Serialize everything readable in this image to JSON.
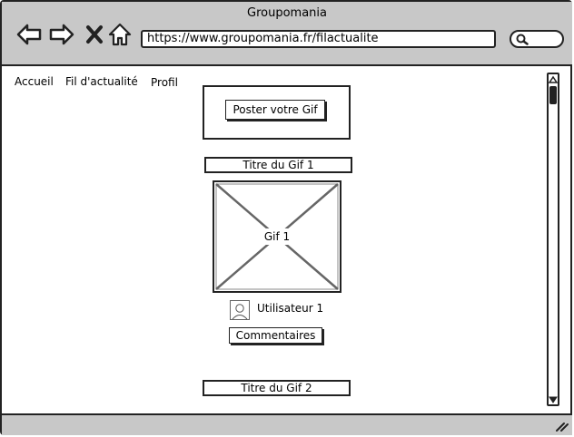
{
  "window": {
    "title": "Groupomania"
  },
  "toolbar": {
    "url": "https://www.groupomania.fr/filactualite",
    "icons": [
      "back-arrow-icon",
      "forward-arrow-icon",
      "close-x-icon",
      "home-icon",
      "search-icon"
    ]
  },
  "nav": {
    "accueil": "Accueil",
    "fil": "Fil d'actualité",
    "profil": "Profil"
  },
  "feed": {
    "post_button": "Poster votre Gif",
    "gif1": {
      "title": "Titre du Gif 1",
      "image_label": "Gif 1",
      "user": "Utilisateur 1",
      "comments_button": "Commentaires"
    },
    "gif2": {
      "title": "Titre du Gif 2"
    }
  },
  "colors": {
    "chrome": "#c8c8c8",
    "stroke": "#222222",
    "background": "#ffffff"
  }
}
